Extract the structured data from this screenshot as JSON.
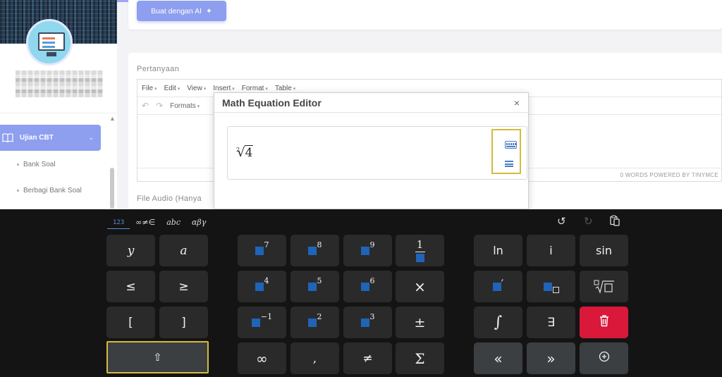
{
  "sidebar": {
    "menu_active_label": "Ujian CBT",
    "sub_items": [
      "Bank Soal",
      "Berbagi Bank Soal"
    ]
  },
  "main": {
    "ai_button_label": "Buat dengan AI",
    "question_label": "Pertanyaan",
    "audio_label": "File Audio (Hanya",
    "editor": {
      "menus": [
        "File",
        "Edit",
        "View",
        "Insert",
        "Format",
        "Table"
      ],
      "formats_label": "Formats",
      "status": "0 WORDS POWERED BY TINYMCE"
    }
  },
  "dialog": {
    "title": "Math Equation Editor",
    "close": "×",
    "expression": {
      "index": "2",
      "radicand": "4"
    }
  },
  "keyboard": {
    "tabs": [
      "123",
      "∞≠∈",
      "abc",
      "αβγ"
    ],
    "keys": {
      "y": "y",
      "a": "a",
      "le": "≤",
      "ge": "≥",
      "lbr": "[",
      "rbr": "]",
      "p7": "7",
      "p8": "8",
      "p9": "9",
      "frac_num": "1",
      "p4": "4",
      "p5": "5",
      "p6": "6",
      "times": "×",
      "pm1": "−1",
      "p2": "2",
      "p3": "3",
      "pm": "±",
      "inf": "∞",
      "comma": ",",
      "neq": "≠",
      "sum": "Σ",
      "ln": "ln",
      "i": "i",
      "sin": "sin",
      "prime": "′",
      "int": "∫",
      "exists": "∃",
      "left": "«",
      "right": "»"
    }
  },
  "accent_colors": {
    "primary": "#8e9ff0",
    "highlight": "#d4bb3c",
    "delete": "#d9183a",
    "placeholder": "#1f64b7"
  }
}
